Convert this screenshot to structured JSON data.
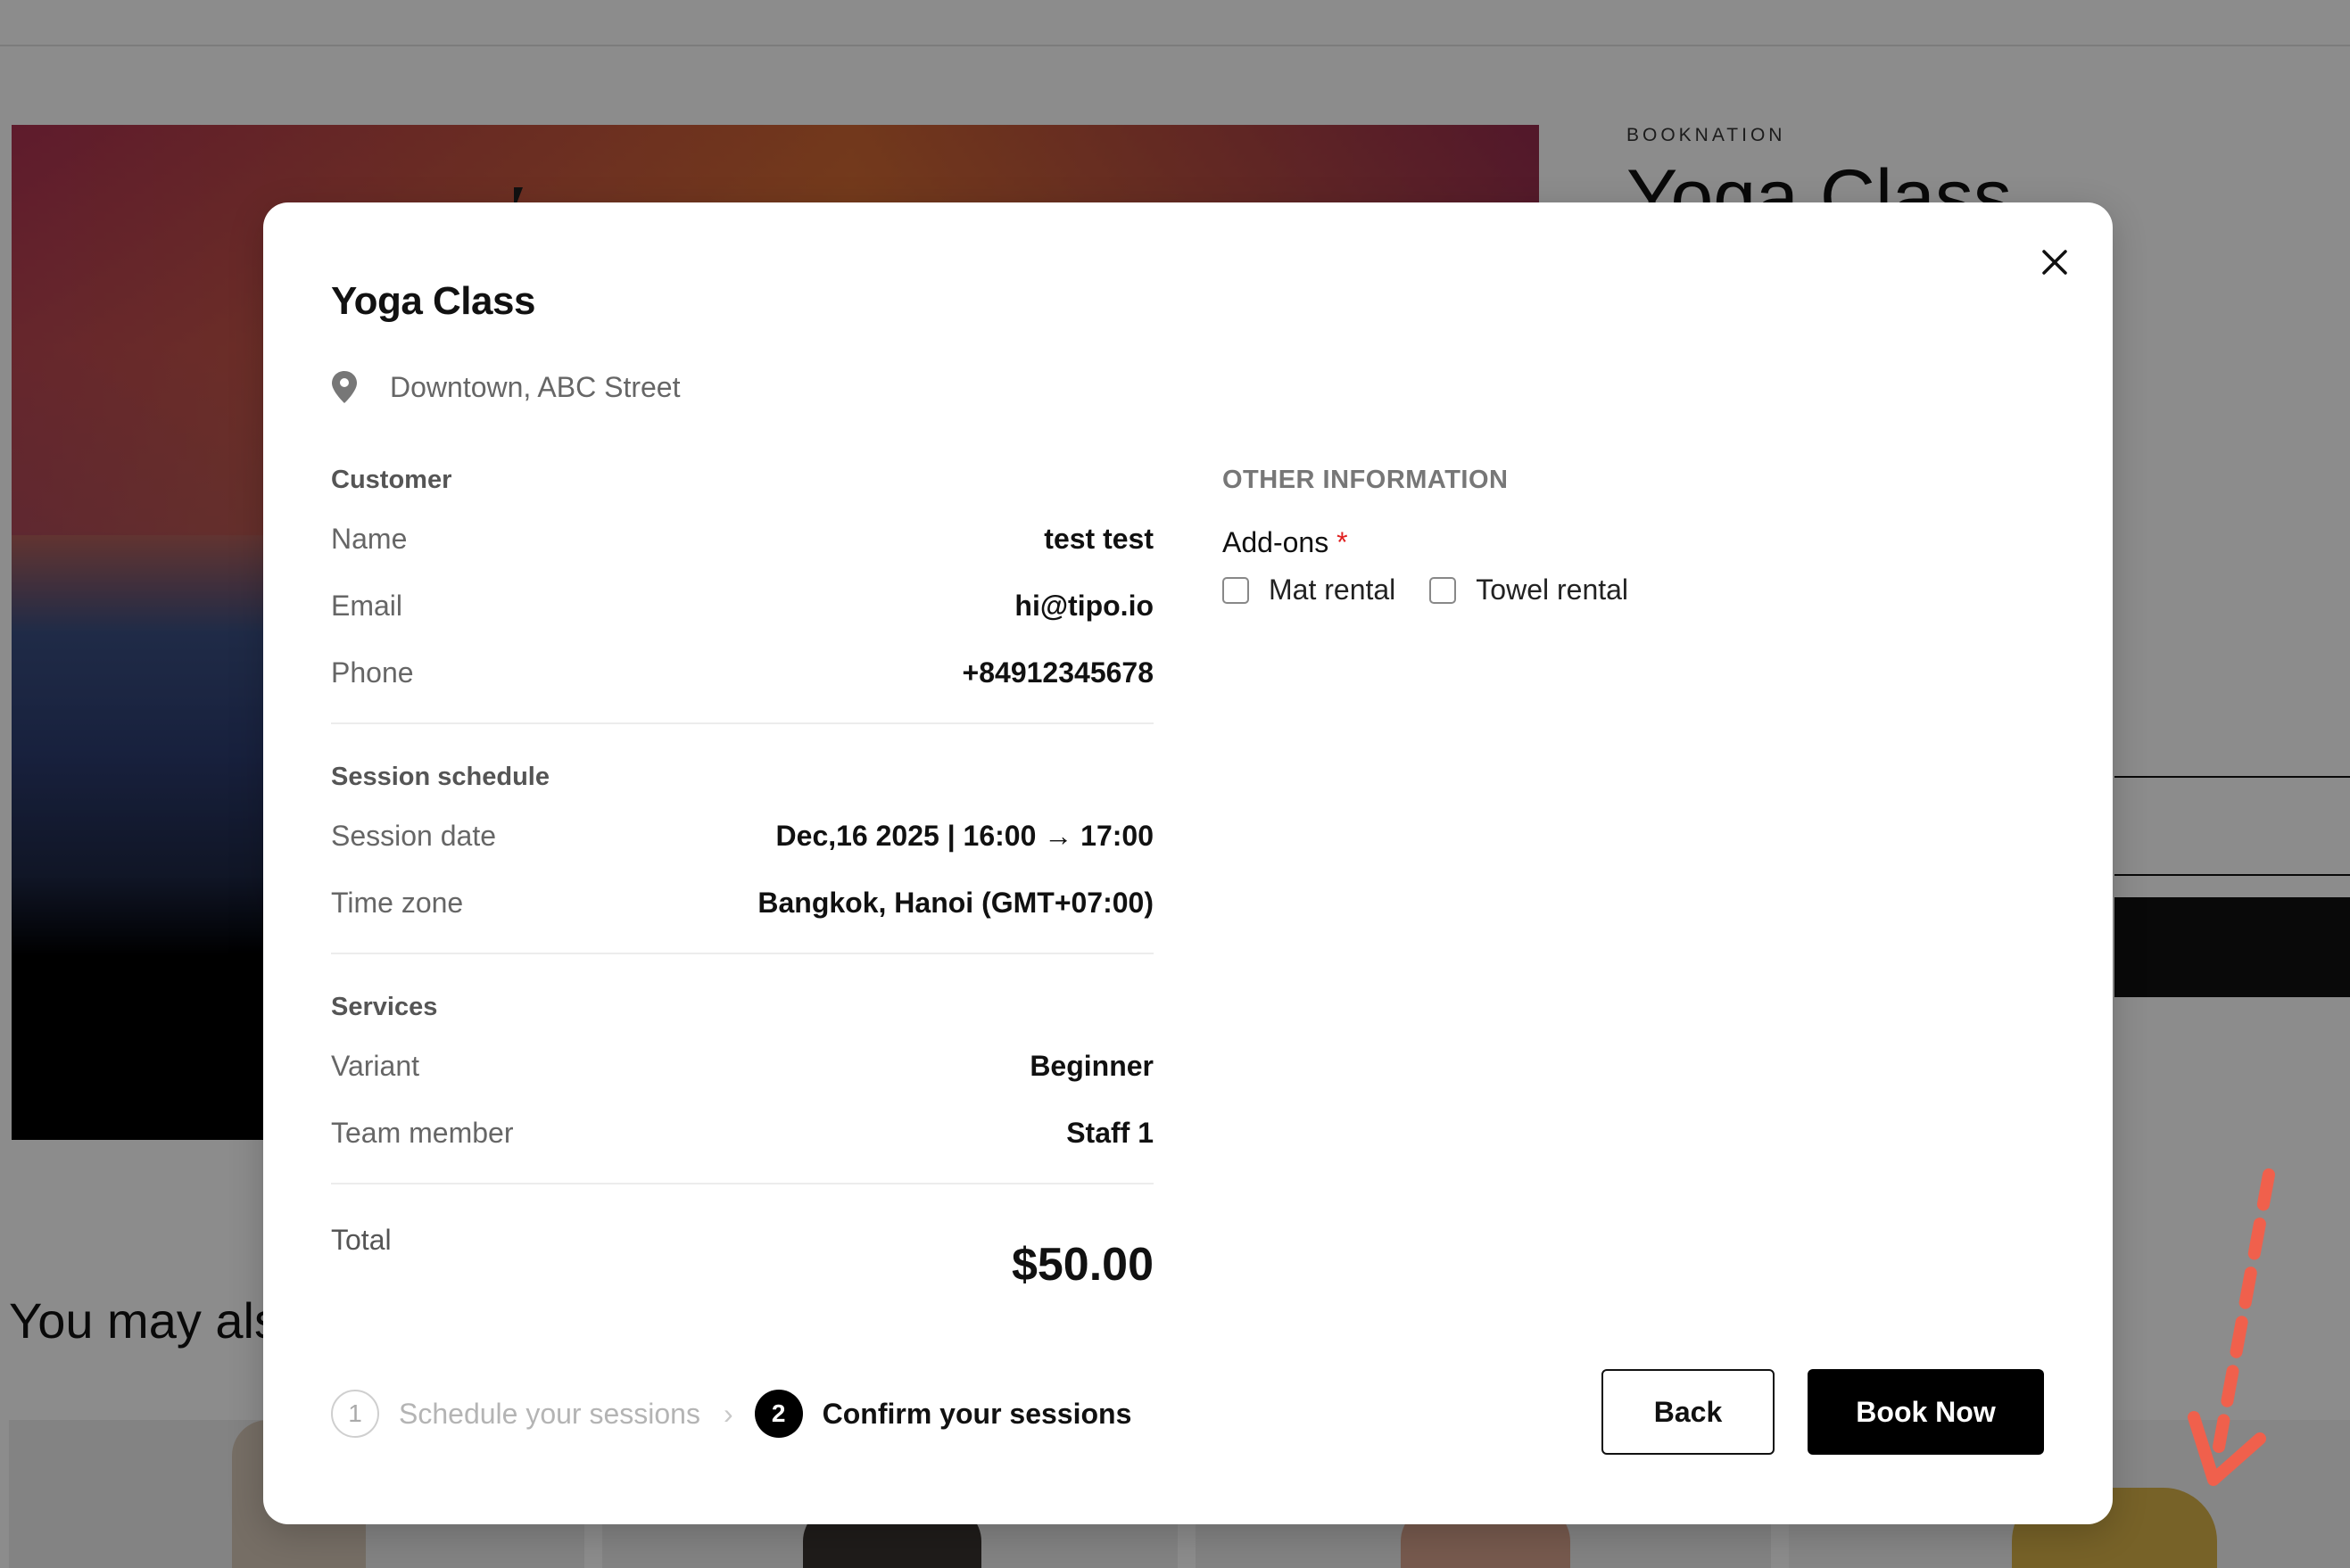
{
  "background": {
    "brand": "BOOKNATION",
    "product_title": "Yoga Class",
    "section_title": "You may also like"
  },
  "modal": {
    "title": "Yoga Class",
    "location": "Downtown, ABC Street",
    "close_icon": "close-icon",
    "location_icon": "map-pin-icon",
    "customer": {
      "heading": "Customer",
      "rows": [
        {
          "label": "Name",
          "value": "test test"
        },
        {
          "label": "Email",
          "value": "hi@tipo.io"
        },
        {
          "label": "Phone",
          "value": "+84912345678"
        }
      ]
    },
    "schedule": {
      "heading": "Session schedule",
      "rows": [
        {
          "label": "Session date",
          "value": "Dec,16 2025 | 16:00 → 17:00"
        },
        {
          "label": "Time zone",
          "value": "Bangkok, Hanoi (GMT+07:00)"
        }
      ]
    },
    "services": {
      "heading": "Services",
      "rows": [
        {
          "label": "Variant",
          "value": "Beginner"
        },
        {
          "label": "Team member",
          "value": "Staff 1"
        }
      ]
    },
    "total": {
      "label": "Total",
      "value": "$50.00"
    },
    "other_info": {
      "heading": "OTHER INFORMATION",
      "addons_label": "Add-ons",
      "required_mark": "*",
      "options": [
        {
          "label": "Mat rental",
          "checked": false
        },
        {
          "label": "Towel rental",
          "checked": false
        }
      ]
    },
    "stepper": {
      "steps": [
        {
          "number": "1",
          "label": "Schedule your sessions",
          "active": false
        },
        {
          "number": "2",
          "label": "Confirm your sessions",
          "active": true
        }
      ],
      "separator": "›"
    },
    "buttons": {
      "back": "Back",
      "book": "Book Now"
    }
  },
  "colors": {
    "primary": "#000000",
    "required": "#e02020",
    "annotation_arrow": "#f0604c"
  }
}
